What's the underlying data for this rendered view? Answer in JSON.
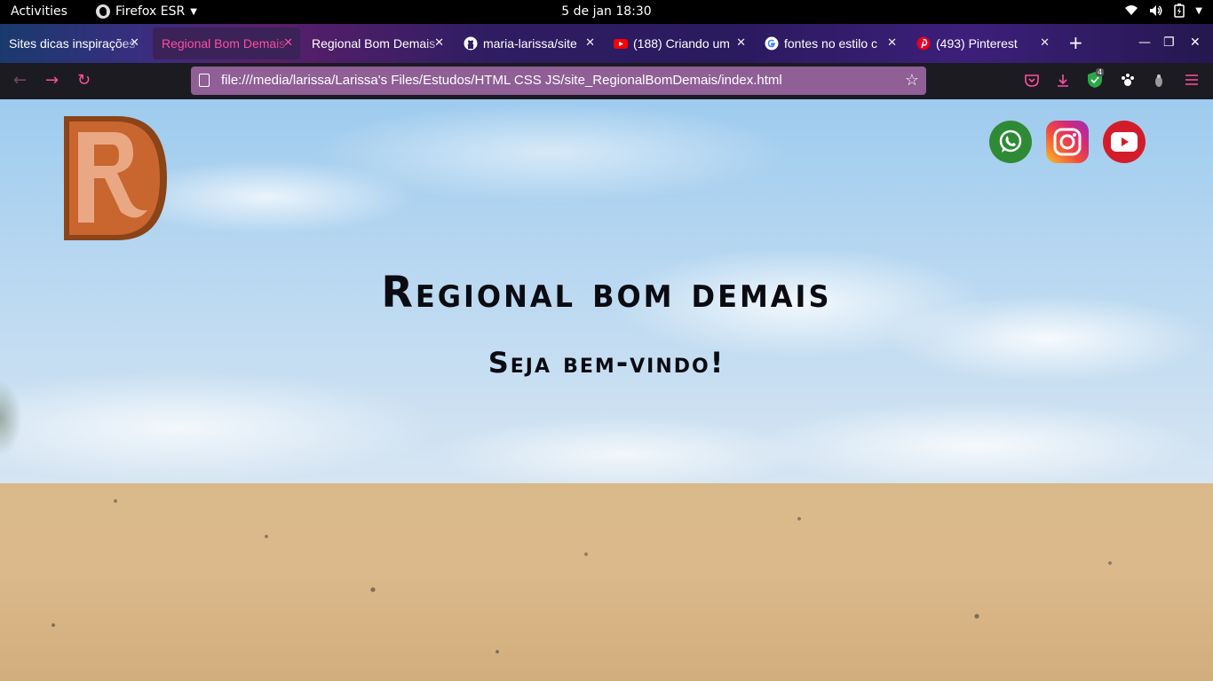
{
  "topbar": {
    "activities": "Activities",
    "app_name": "Firefox ESR",
    "clock": "5 de jan  18:30"
  },
  "tabs": [
    {
      "title": "Sites dicas inspirações",
      "active": false
    },
    {
      "title": "Regional Bom Demais",
      "active": true
    },
    {
      "title": "Regional Bom Demais",
      "active": false
    },
    {
      "title": "maria-larissa/site",
      "favicon": "github-icon",
      "active": false
    },
    {
      "title": "(188) Criando um",
      "favicon": "youtube-icon",
      "active": false
    },
    {
      "title": "fontes no estilo c",
      "favicon": "google-icon",
      "active": false
    },
    {
      "title": "(493) Pinterest",
      "favicon": "pinterest-icon",
      "active": false
    }
  ],
  "toolbar": {
    "url": "file:///media/larissa/Larissa's Files/Estudos/HTML CSS JS/site_RegionalBomDemais/index.html",
    "extension_badge": "4"
  },
  "page": {
    "title": "Regional bom demais",
    "subtitle": "Seja bem-vindo!",
    "logo_letter": "R",
    "social": [
      "whatsapp-icon",
      "instagram-icon",
      "youtube-icon"
    ]
  },
  "colors": {
    "accent_pink": "#ff4fa0",
    "urlbar": "#8f5f96",
    "logo_brown": "#c9652f",
    "youtube_red": "#d31c2a",
    "whatsapp_green": "#2e8a35"
  }
}
